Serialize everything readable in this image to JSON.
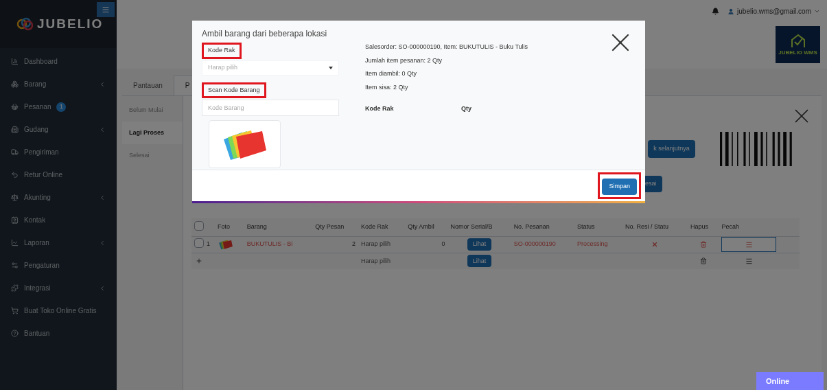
{
  "sidebar": {
    "brand": "JUBELIO",
    "items": [
      {
        "label": "Dashboard",
        "expandable": false
      },
      {
        "label": "Barang",
        "expandable": true
      },
      {
        "label": "Pesanan",
        "expandable": false,
        "badge": "1"
      },
      {
        "label": "Gudang",
        "expandable": true
      },
      {
        "label": "Pengiriman",
        "expandable": false
      },
      {
        "label": "Retur Online",
        "expandable": false
      },
      {
        "label": "Akunting",
        "expandable": true
      },
      {
        "label": "Kontak",
        "expandable": false
      },
      {
        "label": "Laporan",
        "expandable": true
      },
      {
        "label": "Pengaturan",
        "expandable": false
      },
      {
        "label": "Integrasi",
        "expandable": true
      },
      {
        "label": "Buat Toko Online Gratis",
        "expandable": false
      },
      {
        "label": "Bantuan",
        "expandable": false
      }
    ]
  },
  "header": {
    "user": "jubelio.wms@gmail.com",
    "logo_text": "JUBELIO WMS"
  },
  "tabs": [
    {
      "label": "Pantauan",
      "selected": false
    },
    {
      "label": "P",
      "selected": true
    }
  ],
  "status_tabs": [
    {
      "label": "Belum Mulai",
      "selected": false
    },
    {
      "label": "Lagi Proses",
      "selected": true
    },
    {
      "label": "Selesai",
      "selected": false
    }
  ],
  "panel": {
    "next_button": "k selanjutnya",
    "finish_button": "esai"
  },
  "table": {
    "columns": [
      "Foto",
      "Barang",
      "Qty Pesan",
      "Kode Rak",
      "Qty Ambil",
      "Nomor Serial/B",
      "No. Pesanan",
      "Status",
      "No. Resi / Statu",
      "Hapus",
      "Pecah"
    ],
    "header_checked": false,
    "rows": [
      {
        "kind": "item",
        "checked": false,
        "number": "1",
        "barang": "BUKUTULIS - Bi",
        "qty_pesan": "2",
        "kode_rak": "Harap pilih",
        "qty_ambil": "0",
        "serial": "Lihat",
        "no_pesanan": "SO-000000190",
        "status": "Processing",
        "resi_ok": false,
        "focused": true
      },
      {
        "kind": "add",
        "kode_rak": "Harap pilih",
        "serial": "Lihat",
        "focused": false
      }
    ]
  },
  "modal": {
    "title": "Ambil barang dari beberapa lokasi",
    "rack_label": "Kode Rak",
    "rack_placeholder": "Harap pilih",
    "scan_label": "Scan Kode Barang",
    "scan_placeholder": "Kode Barang",
    "info": [
      "Salesorder: SO-000000190, Item: BUKUTULIS - Buku Tulis",
      "Jumlah item pesanan: 2 Qty",
      "Item diambil: 0 Qty",
      "Item sisa: 2 Qty"
    ],
    "columns": [
      "Kode Rak",
      "Qty"
    ],
    "save": "Simpan"
  },
  "chat": {
    "label": "Online"
  }
}
